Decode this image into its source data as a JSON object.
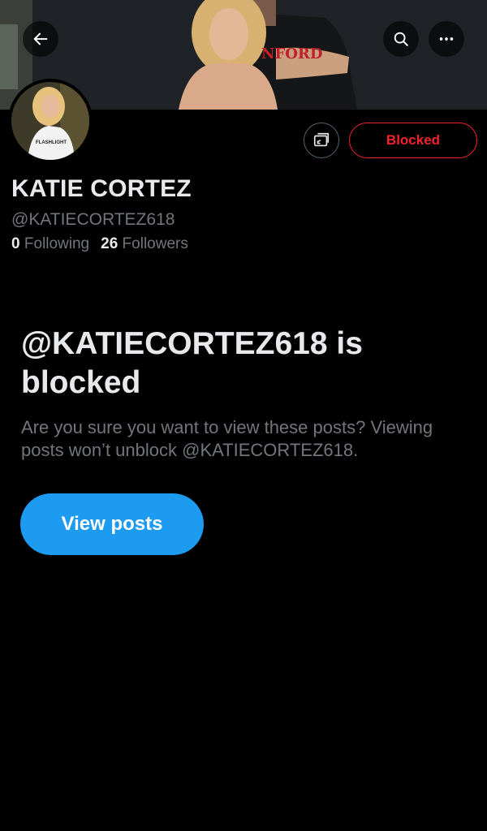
{
  "header": {
    "back_icon": "arrow-left-icon",
    "search_icon": "search-icon",
    "more_icon": "more-horizontal-icon"
  },
  "banner": {
    "shirt_text": "NFORD"
  },
  "avatar": {
    "shirt_text": "FLASHLIGHT"
  },
  "actions": {
    "cast_icon": "cast-icon",
    "blocked_label": "Blocked"
  },
  "profile": {
    "name": "KATIE CORTEZ",
    "handle": "@KATIECORTEZ618",
    "following_count": "0",
    "following_label": "Following",
    "followers_count": "26",
    "followers_label": "Followers"
  },
  "blocked_notice": {
    "title": "@KATIECORTEZ618 is blocked",
    "description": "Are you sure you want to view these posts? Viewing posts won’t unblock @KATIECORTEZ618.",
    "button_label": "View posts"
  },
  "colors": {
    "background": "#000000",
    "primary_text": "#e7e9ea",
    "secondary_text": "#71767b",
    "danger": "#f4212e",
    "accent": "#1d9bf0"
  }
}
